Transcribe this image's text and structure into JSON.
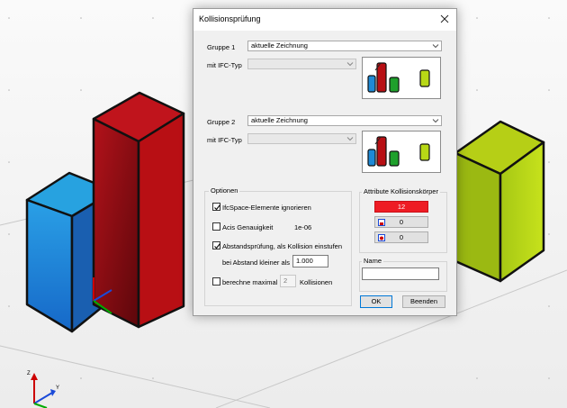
{
  "dialog": {
    "title": "Kollisionsprüfung",
    "group1": {
      "label": "Gruppe 1",
      "source": "aktuelle Zeichnung",
      "ifc_label": "mit IFC-Typ",
      "ifc_value": ""
    },
    "group2": {
      "label": "Gruppe 2",
      "source": "aktuelle Zeichnung",
      "ifc_label": "mit IFC-Typ",
      "ifc_value": ""
    },
    "options": {
      "title": "Optionen",
      "ignore_ifcspace": {
        "label": "IfcSpace-Elemente ignorieren",
        "checked": true
      },
      "acis": {
        "label": "Acis Genauigkeit",
        "checked": false,
        "value": "1e-06"
      },
      "distance_check": {
        "label": "Abstandsprüfung, als Kollision einstufen",
        "checked": true
      },
      "distance": {
        "label": "bei Abstand kleiner als",
        "value": "1.000"
      },
      "max_collisions": {
        "prefix": "berechne maximal",
        "value": "2",
        "suffix": "Kollisionen",
        "checked": false
      }
    },
    "attributes": {
      "title": "Attribute Kollisionskörper",
      "color_value": "12",
      "color_hex": "#ee1c24",
      "btn2_value": "0",
      "btn3_value": "0"
    },
    "name": {
      "label": "Name",
      "value": ""
    },
    "ok_label": "OK",
    "close_label": "Beenden"
  },
  "colors": {
    "blue": "#1e8ad6",
    "red": "#b80f14",
    "yellow_green": "#b8d816"
  }
}
